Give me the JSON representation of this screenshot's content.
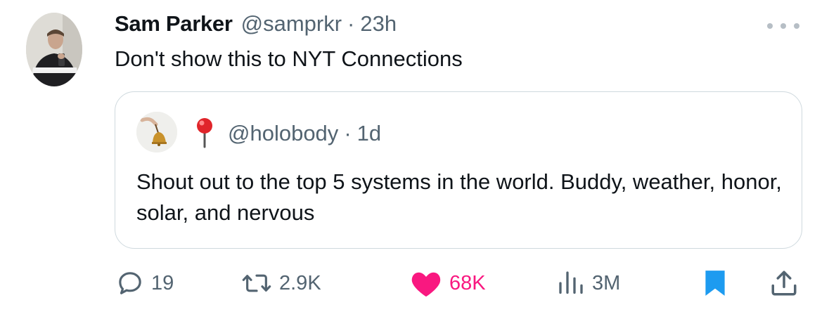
{
  "tweet": {
    "author": {
      "display_name": "Sam Parker",
      "handle": "@samprkr",
      "separator": "·",
      "time": "23h"
    },
    "text": "Don't show this to NYT Connections",
    "more_icon": "more-horizontal-icon"
  },
  "quoted_tweet": {
    "handle": "@holobody",
    "separator": "·",
    "time": "1d",
    "emoji_icon": "round-pushpin-icon",
    "text": "Shout out to the top 5 systems in the world. Buddy, weather, honor, solar, and nervous"
  },
  "actions": {
    "replies": "19",
    "retweets": "2.9K",
    "likes": "68K",
    "views": "3M",
    "liked": true,
    "bookmarked": true
  },
  "colors": {
    "text_primary": "#0f1419",
    "text_secondary": "#536471",
    "like_pink": "#f91880",
    "bookmark_blue": "#1d9bf0",
    "border": "#cfd9de"
  }
}
